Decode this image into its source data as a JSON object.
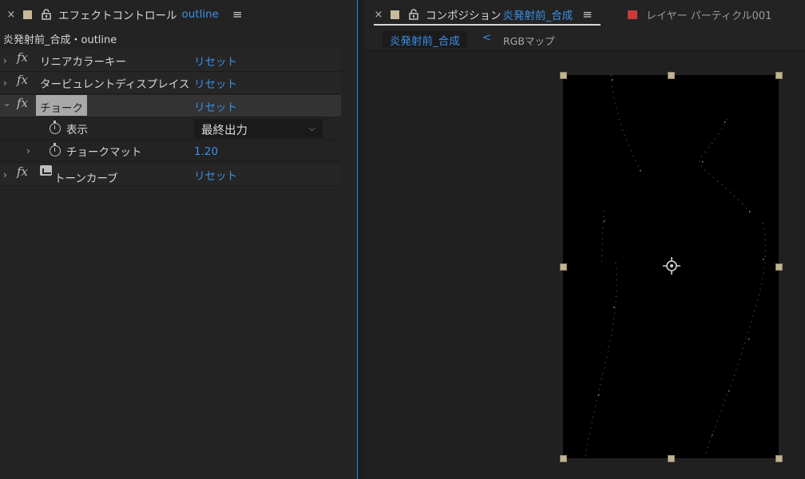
{
  "effect_controls": {
    "tab": {
      "close": "×",
      "title": "エフェクトコントロール",
      "layer": "outline",
      "menu": "≡",
      "swatch_color": "#c8b99a"
    },
    "layer_path": "炎発射前_合成・outline",
    "effects": [
      {
        "name": "リニアカラーキー",
        "reset": "リセット",
        "expanded": false
      },
      {
        "name": "タービュレントディスプレイス",
        "reset": "リセット",
        "expanded": false
      },
      {
        "name": "チョーク",
        "reset": "リセット",
        "expanded": true,
        "selected": true,
        "properties": [
          {
            "name": "表示",
            "type": "dropdown",
            "value": "最終出力"
          },
          {
            "name": "チョークマット",
            "type": "number",
            "value": "1.20"
          }
        ]
      },
      {
        "name": "トーンカーブ",
        "reset": "リセット",
        "expanded": false
      }
    ],
    "fx_label": "fx"
  },
  "composition": {
    "tab": {
      "close": "×",
      "title": "コンポジション",
      "name": "炎発射前_合成",
      "menu": "≡",
      "swatch_color": "#c8b99a"
    },
    "layer_tab": {
      "title": "レイヤー パーティクル001",
      "swatch_color": "#c93a3a"
    },
    "breadcrumb": {
      "active": "炎発射前_合成",
      "arrow": "<",
      "next": "RGBマップ"
    }
  },
  "colors": {
    "accent_blue": "#3b8fe6",
    "panel_bg": "#232323",
    "handle": "#c0b493"
  }
}
